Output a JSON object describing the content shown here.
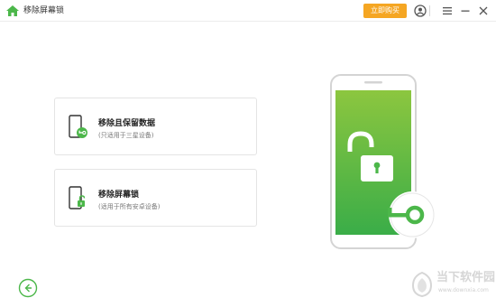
{
  "titlebar": {
    "title": "移除屏幕锁",
    "buy_label": "立即购买",
    "icons": [
      "home-icon",
      "account-icon",
      "menu-icon",
      "minimize-icon",
      "close-icon"
    ]
  },
  "options": [
    {
      "title": "移除且保留数据",
      "subtitle": "(只适用于三星设备)",
      "icon": "phone-key-icon"
    },
    {
      "title": "移除屏幕锁",
      "subtitle": "(适用于所有安卓设备)",
      "icon": "phone-unlock-icon"
    }
  ],
  "hero": {
    "icons": [
      "phone-illustration",
      "padlock-open-icon",
      "key-icon"
    ]
  },
  "footer": {
    "back_icon": "back-arrow-icon"
  },
  "watermark": {
    "text": "当下软件园",
    "url": "www.downxia.com"
  },
  "colors": {
    "accent_green": "#4cb74a",
    "buy_button": "#f5a623",
    "screen_green_top": "#8cc63f",
    "screen_green_bottom": "#3aad48"
  }
}
